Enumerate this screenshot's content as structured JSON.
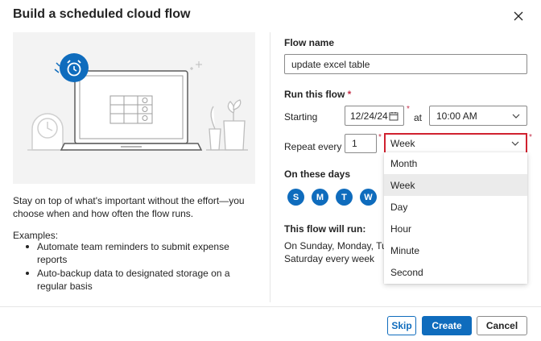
{
  "dialog": {
    "title": "Build a scheduled cloud flow"
  },
  "left": {
    "description": "Stay on top of what's important without the effort—you choose when and how often the flow runs.",
    "examples_label": "Examples:",
    "examples": [
      "Automate team reminders to submit expense reports",
      "Auto-backup data to designated storage on a regular basis"
    ]
  },
  "form": {
    "flow_name_label": "Flow name",
    "flow_name_value": "update excel table",
    "run_label": "Run this flow",
    "required_mark": "*",
    "starting_label": "Starting",
    "start_date": "12/24/24",
    "at_label": "at",
    "start_time": "10:00 AM",
    "repeat_label": "Repeat every",
    "interval_value": "1",
    "frequency_value": "Week",
    "frequency_options": [
      "Month",
      "Week",
      "Day",
      "Hour",
      "Minute",
      "Second"
    ],
    "selected_option": "Week",
    "days_label": "On these days",
    "days": [
      "S",
      "M",
      "T",
      "W"
    ],
    "summary_label": "This flow will run:",
    "summary_line1": "On Sunday, Monday, Tuesc",
    "summary_line2": "Saturday every week"
  },
  "footer": {
    "skip_label": "Skip",
    "create_label": "Create",
    "cancel_label": "Cancel"
  },
  "colors": {
    "primary": "#0f6cbd",
    "focus_border": "#d0212f",
    "required": "#c4314b"
  }
}
